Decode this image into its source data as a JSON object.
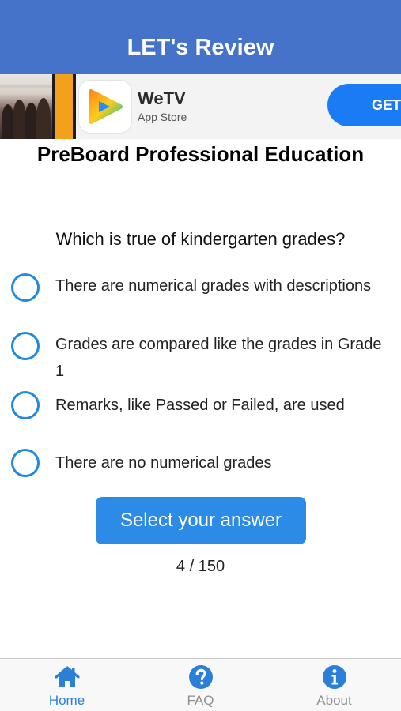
{
  "header": {
    "title": "LET's Review"
  },
  "ad": {
    "app_name": "WeTV",
    "store": "App Store",
    "cta": "GET",
    "icon": "wetv-play-icon",
    "cta_color": "#1a7cf5"
  },
  "quiz": {
    "subject": "PreBoard Professional Education",
    "question": "Which is true of kindergarten grades?",
    "options": [
      {
        "label": "There are numerical grades with descriptions"
      },
      {
        "label": "Grades are compared like the grades in Grade 1"
      },
      {
        "label": "Remarks, like Passed or Failed, are used"
      },
      {
        "label": "There are no numerical grades"
      }
    ],
    "submit_label": "Select your answer",
    "progress": "4 / 150"
  },
  "tabs": [
    {
      "label": "Home",
      "icon": "home-icon",
      "active": true
    },
    {
      "label": "FAQ",
      "icon": "question-circle-icon",
      "active": false
    },
    {
      "label": "About",
      "icon": "info-circle-icon",
      "active": false
    }
  ],
  "colors": {
    "header": "#4473c9",
    "accent": "#2b8be6",
    "radio": "#1f8ae0",
    "tab_active": "#2b7fd9",
    "tab_inactive": "#8e8e93"
  }
}
